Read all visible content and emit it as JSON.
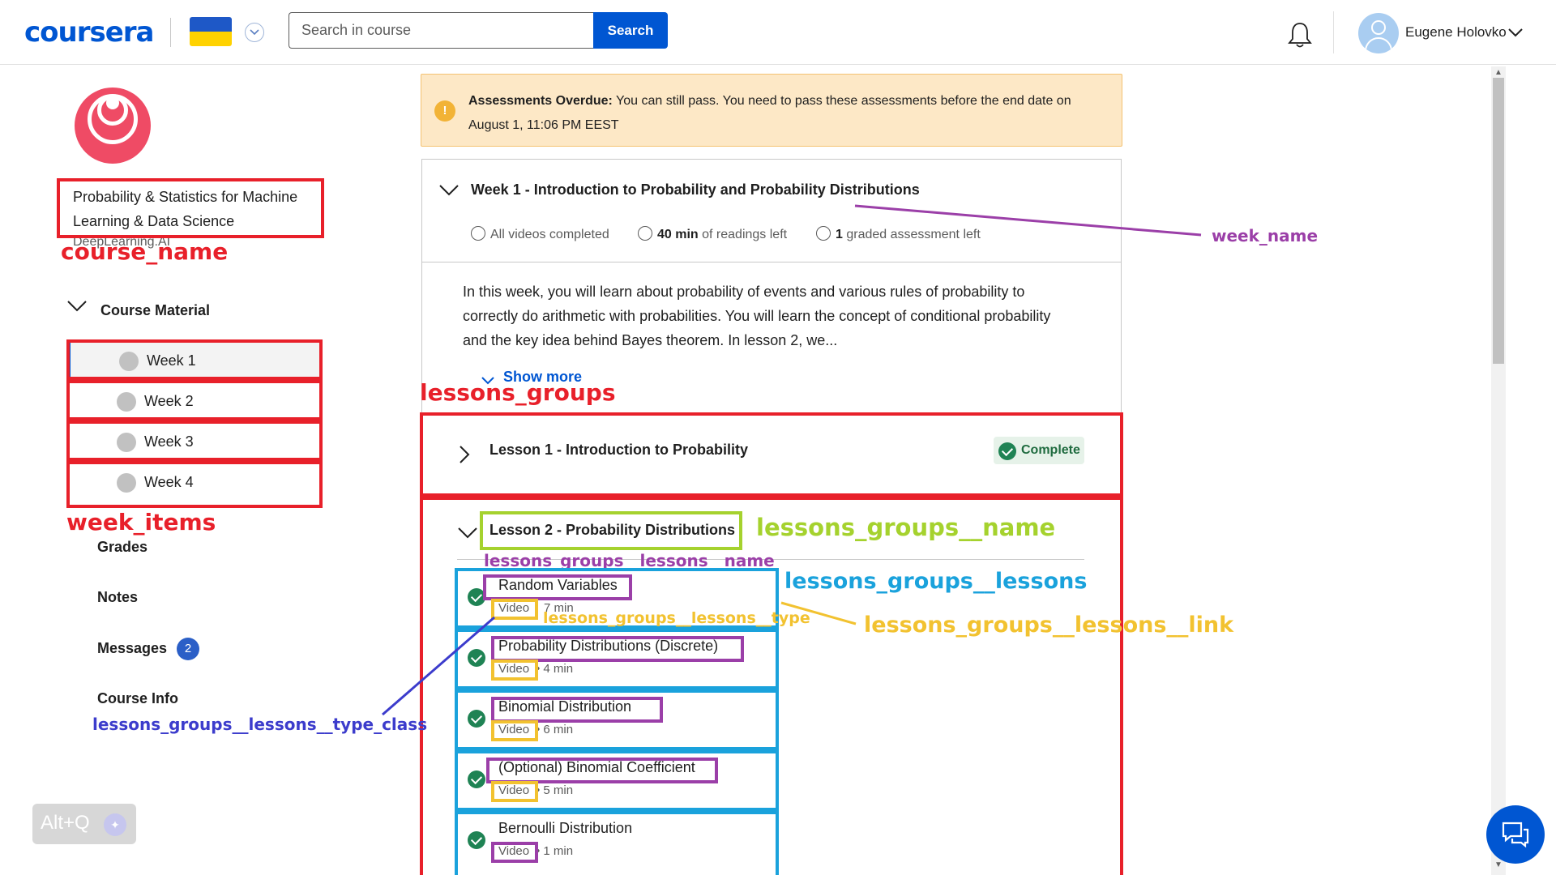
{
  "header": {
    "logo": "coursera",
    "search_placeholder": "Search in course",
    "search_button": "Search",
    "user_name": "Eugene Holovko"
  },
  "sidebar": {
    "course_name": "Probability & Statistics for Machine Learning & Data Science",
    "partner": "DeepLearning.AI",
    "course_material_label": "Course Material",
    "weeks": [
      {
        "label": "Week 1"
      },
      {
        "label": "Week 2"
      },
      {
        "label": "Week 3"
      },
      {
        "label": "Week 4"
      }
    ],
    "links": {
      "grades": "Grades",
      "notes": "Notes",
      "messages": "Messages",
      "course_info": "Course Info"
    },
    "messages_count": "2",
    "altq_label": "Alt+Q"
  },
  "alert": {
    "title": "Assessments Overdue:",
    "text": "You can still pass. You need to pass these assessments before the end date on August 1, 11:06 PM EEST"
  },
  "week": {
    "title": "Week 1 - Introduction to Probability and Probability Distributions",
    "stat_videos": "All videos completed",
    "stat_readings_bold": "40 min",
    "stat_readings_rest": "of readings left",
    "stat_assessments_bold": "1",
    "stat_assessments_rest": "graded assessment left",
    "description": "In this week, you will learn about probability of events and various rules of probability to correctly do arithmetic with probabilities. You will learn the concept of conditional probability and the key idea behind Bayes theorem. In lesson 2, we...",
    "show_more": "Show more"
  },
  "lessons": {
    "lesson1": {
      "name": "Lesson 1 - Introduction to Probability",
      "status": "Complete"
    },
    "lesson2": {
      "name": "Lesson 2 - Probability Distributions"
    },
    "items": [
      {
        "name": "Random Variables",
        "type": "Video",
        "duration": "7 min"
      },
      {
        "name": "Probability Distributions (Discrete)",
        "type": "Video",
        "duration": "• 4 min"
      },
      {
        "name": "Binomial Distribution",
        "type": "Video",
        "duration": "• 6 min"
      },
      {
        "name": "(Optional) Binomial Coefficient",
        "type": "Video",
        "duration": "• 5 min"
      },
      {
        "name": "Bernoulli Distribution",
        "type": "Video",
        "duration": "• 1 min"
      }
    ]
  },
  "annotations": {
    "course_name": "course_name",
    "week_items": "week_items",
    "week_name": "week_name",
    "lessons_groups": "lessons_groups",
    "lessons_groups__name": "lessons_groups__name",
    "lessons_groups__lessons__name": "lessons_groups__lessons__name",
    "lessons_groups__lessons": "lessons_groups__lessons",
    "lessons_groups__lessons__type": "lessons_groups__lessons__type",
    "lessons_groups__lessons__link": "lessons_groups__lessons__link",
    "lessons_groups__lessons__type_class": "lessons_groups__lessons__type_class"
  },
  "colors": {
    "brand": "#0056d2",
    "annotation_red": "#e8202a",
    "annotation_purple": "#9b3fa8",
    "annotation_yellow": "#f2c230",
    "annotation_blue": "#1aa2dc",
    "annotation_green": "#a5d22e",
    "annotation_navy": "#3c3ccc",
    "complete_green": "#1f8354"
  }
}
